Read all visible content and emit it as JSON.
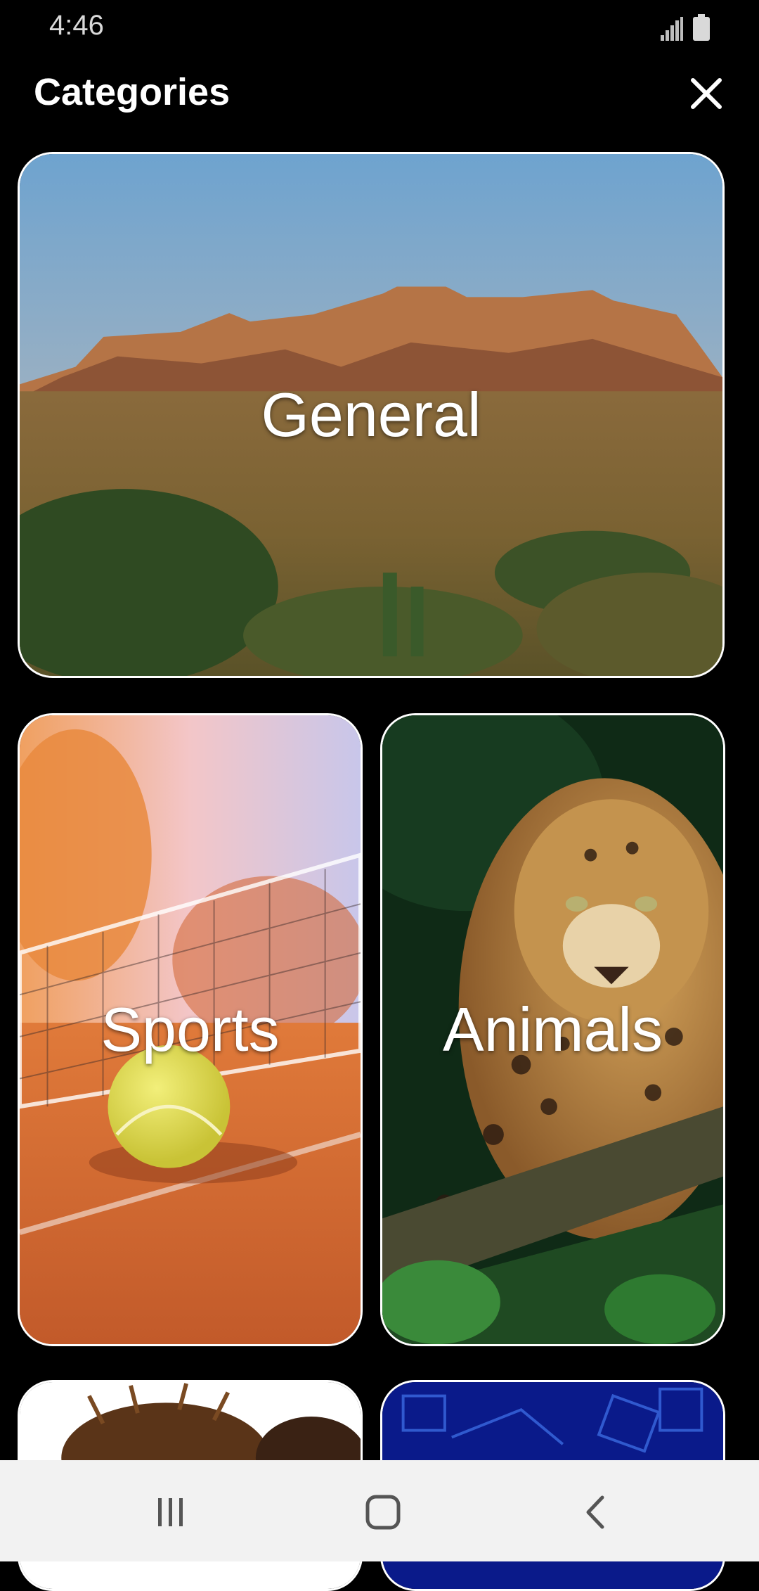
{
  "status_bar": {
    "time": "4:46",
    "signal_icon": "signal-icon",
    "battery_icon": "battery-icon"
  },
  "header": {
    "title": "Categories",
    "close_icon": "close-icon"
  },
  "categories": [
    {
      "label": "General"
    },
    {
      "label": "Sports"
    },
    {
      "label": "Animals"
    },
    {
      "label": ""
    },
    {
      "label": ""
    }
  ],
  "nav": {
    "recents_icon": "recents-icon",
    "home_icon": "home-icon",
    "back_icon": "back-icon"
  },
  "colors": {
    "background": "#000000",
    "text": "#ffffff",
    "nav_bar": "#f2f2f2",
    "card_border": "#ffffff"
  }
}
